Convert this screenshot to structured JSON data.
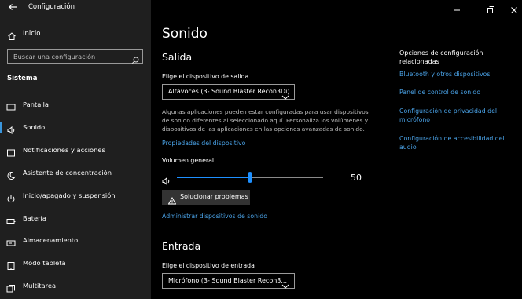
{
  "sidebar": {
    "app_title": "Configuración",
    "home_label": "Inicio",
    "search_placeholder": "Buscar una configuración",
    "section_label": "Sistema",
    "items": [
      {
        "label": "Pantalla",
        "icon": "monitor-icon"
      },
      {
        "label": "Sonido",
        "icon": "speaker-icon",
        "active": true
      },
      {
        "label": "Notificaciones y acciones",
        "icon": "notifications-icon"
      },
      {
        "label": "Asistente de concentración",
        "icon": "moon-icon"
      },
      {
        "label": "Inicio/apagado y suspensión",
        "icon": "power-icon"
      },
      {
        "label": "Batería",
        "icon": "battery-icon"
      },
      {
        "label": "Almacenamiento",
        "icon": "storage-icon"
      },
      {
        "label": "Modo tableta",
        "icon": "tablet-icon"
      },
      {
        "label": "Multitarea",
        "icon": "multitask-icon"
      }
    ]
  },
  "main": {
    "title": "Sonido",
    "output": {
      "heading": "Salida",
      "device_label": "Elige el dispositivo de salida",
      "device_value": "Altavoces (3- Sound Blaster Recon3Di)",
      "description": "Algunas aplicaciones pueden estar configuradas para usar dispositivos de sonido diferentes al seleccionado aquí. Personaliza los volúmenes y dispositivos de las aplicaciones en las opciones avanzadas de sonido.",
      "properties_link": "Propiedades del dispositivo",
      "volume_label": "Volumen general",
      "volume_value": "50",
      "volume_fraction": 0.5,
      "troubleshoot_label": "Solucionar problemas",
      "manage_link": "Administrar dispositivos de sonido"
    },
    "input": {
      "heading": "Entrada",
      "device_label": "Elige el dispositivo de entrada",
      "device_value": "Micrófono (3- Sound Blaster Recon3..."
    }
  },
  "related": {
    "title": "Opciones de configuración relacionadas",
    "links": [
      "Bluetooth y otros dispositivos",
      "Panel de control de sonido",
      "Configuración de privacidad del micrófono",
      "Configuración de accesibilidad del audio"
    ]
  },
  "colors": {
    "accent": "#1e90ff",
    "link": "#4aa3e8",
    "sidebar_bg": "#1f1f1f",
    "main_bg": "#000000"
  }
}
